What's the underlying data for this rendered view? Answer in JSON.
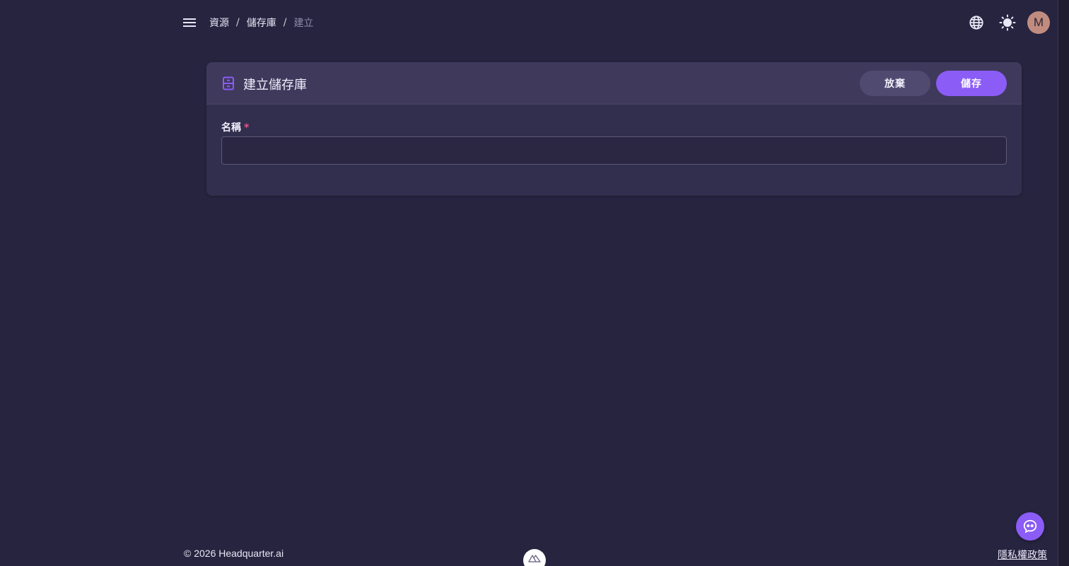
{
  "breadcrumb": {
    "items": [
      "資源",
      "儲存庫",
      "建立"
    ],
    "separator": "/"
  },
  "header": {
    "avatar_initial": "M",
    "icons": [
      "menu-icon",
      "globe-icon",
      "sun-icon"
    ]
  },
  "card": {
    "title": "建立儲存庫",
    "discard_label": "放棄",
    "save_label": "儲存",
    "icon": "storage-icon"
  },
  "form": {
    "name_label": "名稱",
    "required_mark": "*",
    "name_value": "",
    "name_placeholder": ""
  },
  "footer": {
    "copyright": "© 2026 Headquarter.ai",
    "privacy_link": "隱私權政策"
  },
  "colors": {
    "background": "#272440",
    "accent": "#8b5cf6",
    "required": "#e0568a"
  }
}
